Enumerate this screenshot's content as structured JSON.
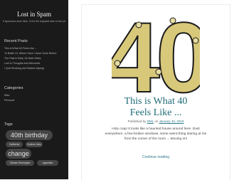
{
  "site": {
    "title": "Lost in Spam",
    "description": "If ignorance were bliss, I'd be the happiest idiot on the planet."
  },
  "sidebar": {
    "recent_posts_title": "Recent Posts",
    "recent_posts": [
      "This is What 40 Feels Like ...",
      "To Bottle Or, Where Have I Have Gone Before",
      "The Past is Real, On Both Sides",
      "Lost in Thoughts and Memories",
      "I Quit Smoking and Started Vaping!"
    ],
    "categories_title": "Categories",
    "categories": [
      "Misc",
      "Personal"
    ],
    "tags_title": "Tags",
    "tags": [
      "40th birthday",
      "California",
      "Custom Jobs",
      "change",
      "Climate Remington",
      "cigarettes"
    ]
  },
  "post": {
    "hero_text": "40",
    "title_line1": "This is What 40",
    "title_line2": "Feels Like ...",
    "published_by_label": "Published by",
    "author": "DML",
    "on_label": "on",
    "date": "January 10, 2019",
    "excerpt_line1": "Holy crap! It looks like a haunted house around here. Dust",
    "excerpt_line2": "everywhere, a few broken windows, some weird thing staring at me",
    "excerpt_line3": "from the corner of the room ... Moving on!",
    "continue_reading": "Continue reading"
  },
  "colors": {
    "sidebar_bg": "#1a1a1a",
    "accent": "#1f6b77",
    "tag_bg": "#454545"
  }
}
